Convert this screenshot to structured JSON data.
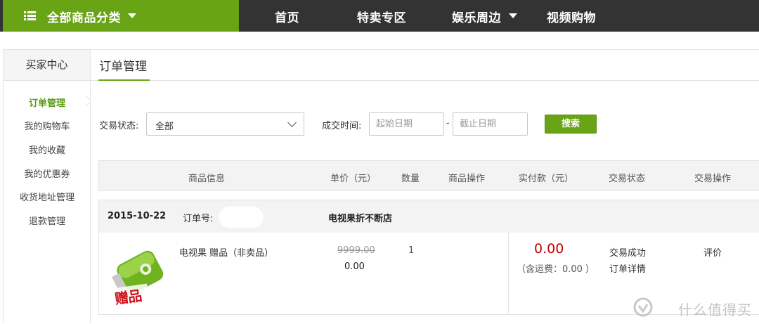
{
  "nav": {
    "category_label": "全部商品分类",
    "links": [
      "首页",
      "特卖专区",
      "娱乐周边",
      "视频购物"
    ]
  },
  "sidebar": {
    "title": "买家中心",
    "items": [
      {
        "label": "订单管理",
        "active": true
      },
      {
        "label": "我的购物车"
      },
      {
        "label": "我的收藏"
      },
      {
        "label": "我的优惠券"
      },
      {
        "label": "收货地址管理"
      },
      {
        "label": "退款管理"
      }
    ]
  },
  "main": {
    "title": "订单管理",
    "filter": {
      "status_label": "交易状态:",
      "status_value": "全部",
      "time_label": "成交时间:",
      "start_placeholder": "起始日期",
      "end_placeholder": "截止日期",
      "range_sep": "-",
      "search_label": "搜索"
    },
    "columns": [
      "商品信息",
      "单价（元）",
      "数量",
      "商品操作",
      "实付款（元）",
      "交易状态",
      "交易操作"
    ],
    "order": {
      "date": "2015-10-22",
      "order_no_label": "订单号:",
      "shop": "电视果折不断店",
      "item_name": "电视果 赠品（非卖品）",
      "thumb_text": "赠品",
      "original_price": "9999.00",
      "unit_price": "0.00",
      "quantity": "1",
      "total": "0.00",
      "shipping_note": "（含运费：0.00 ）",
      "status": "交易成功",
      "detail_link": "订单详情",
      "action": "评价"
    }
  },
  "watermark": {
    "text": "什么值得买"
  },
  "colors": {
    "brand_green": "#69a316",
    "nav_dark": "#333333",
    "price_red": "#c40000"
  }
}
